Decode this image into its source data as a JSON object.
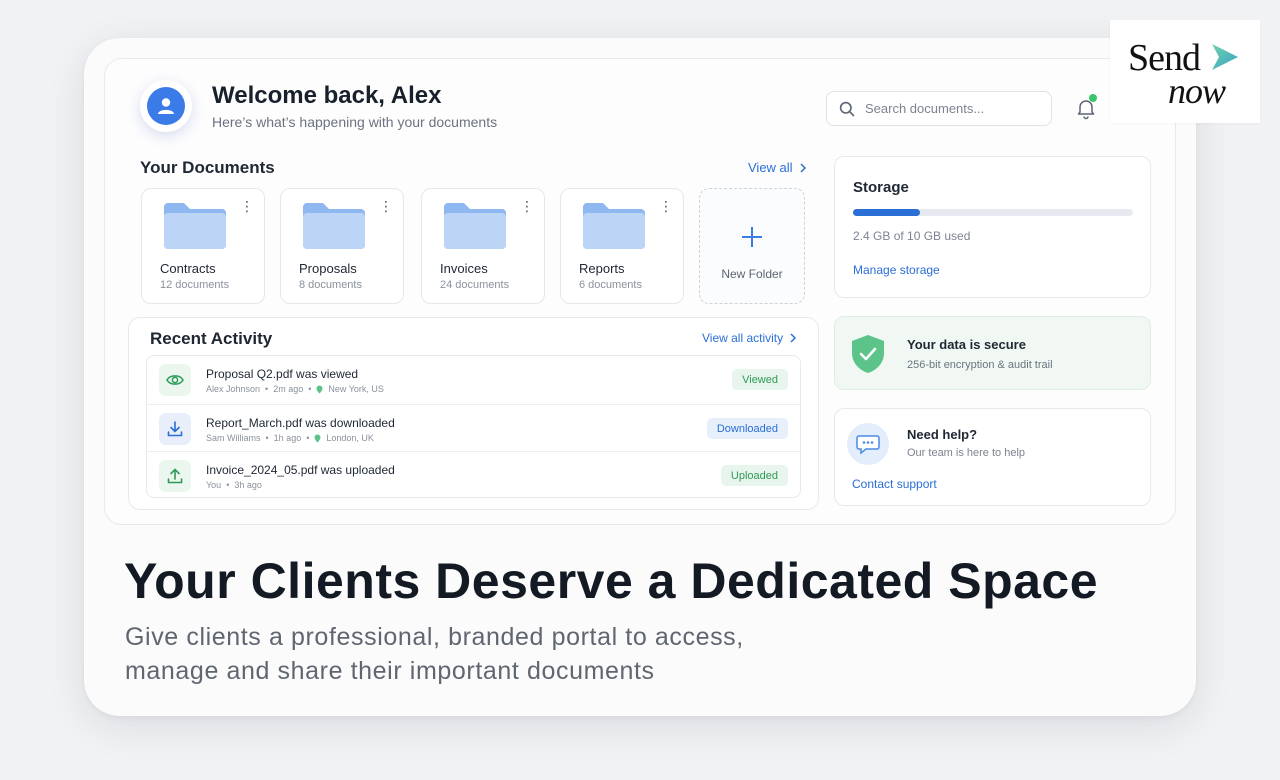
{
  "brand": {
    "logo_word1": "Send",
    "logo_word2": "now",
    "accent": "#2a6fd6",
    "success": "#3cc46a"
  },
  "header": {
    "welcome": "Welcome back, Alex",
    "subtitle": "Here’s what’s happening with your documents",
    "search_placeholder": "Search documents...",
    "avatar_icon": "user-icon",
    "bell_icon": "bell-icon"
  },
  "documents": {
    "title": "Your Documents",
    "view_all": "View all",
    "folders": [
      {
        "name": "Contracts",
        "count": "12 documents"
      },
      {
        "name": "Proposals",
        "count": "8 documents"
      },
      {
        "name": "Invoices",
        "count": "24 documents"
      },
      {
        "name": "Reports",
        "count": "6 documents"
      }
    ],
    "new_folder": "New Folder"
  },
  "activity": {
    "title": "Recent Activity",
    "view_all": "View all activity",
    "items": [
      {
        "title": "Proposal Q2.pdf was viewed",
        "user": "Alex Johnson",
        "time": "2m ago",
        "location": "New York, US",
        "status": "Viewed",
        "icon": "eye-icon"
      },
      {
        "title": "Report_March.pdf was downloaded",
        "user": "Sam Williams",
        "time": "1h ago",
        "location": "London, UK",
        "status": "Downloaded",
        "icon": "download-icon"
      },
      {
        "title": "Invoice_2024_05.pdf was uploaded",
        "user": "You",
        "time": "3h ago",
        "location": "",
        "status": "Uploaded",
        "icon": "upload-icon"
      }
    ]
  },
  "storage": {
    "title": "Storage",
    "used_text": "2.4 GB of 10 GB used",
    "used_fraction": 0.24,
    "manage": "Manage storage"
  },
  "security": {
    "title": "Your data is secure",
    "subtitle": "256-bit encryption & audit trail"
  },
  "help": {
    "title": "Need help?",
    "subtitle": "Our team is here to help",
    "contact": "Contact support"
  },
  "marketing": {
    "headline": "Your Clients Deserve a Dedicated Space",
    "subhead": "Give clients a professional, branded portal to access, manage and share their important documents"
  }
}
